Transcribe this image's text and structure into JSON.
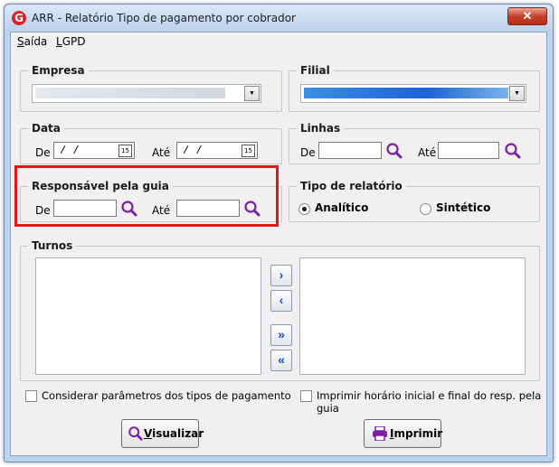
{
  "window": {
    "title": "ARR - Relatório Tipo de pagamento por cobrador",
    "logo_letter": "G",
    "close_glyph": "✕"
  },
  "menu": [
    {
      "label": "Saída",
      "accel_index": 0
    },
    {
      "label": "LGPD",
      "accel_index": 0
    }
  ],
  "empresa": {
    "legend": "Empresa"
  },
  "filial": {
    "legend": "Filial"
  },
  "data": {
    "legend": "Data",
    "from_label": "De",
    "to_label": "Até",
    "from_value": "/ /",
    "to_value": "/ /",
    "calendar_glyph": "15"
  },
  "linhas": {
    "legend": "Linhas",
    "from_label": "De",
    "to_label": "Até",
    "from_value": "",
    "to_value": ""
  },
  "responsavel": {
    "legend": "Responsável pela guia",
    "from_label": "De",
    "to_label": "Até",
    "from_value": "",
    "to_value": ""
  },
  "tipo": {
    "legend": "Tipo de relatório",
    "options": [
      {
        "label": "Analítico",
        "selected": true
      },
      {
        "label": "Sintético",
        "selected": false
      }
    ]
  },
  "turnos": {
    "legend": "Turnos",
    "move_buttons": [
      {
        "glyph": "›"
      },
      {
        "glyph": "‹"
      },
      {
        "glyph": "»"
      },
      {
        "glyph": "«"
      }
    ]
  },
  "options": {
    "considerar_label": "Considerar parâmetros dos tipos de pagamento",
    "considerar_checked": false,
    "imprimir_horario_label": "Imprimir horário inicial e final do resp. pela guia",
    "imprimir_horario_checked": false
  },
  "buttons": {
    "visualizar": "Visualizar",
    "visualizar_accel": "V",
    "imprimir": "Imprimir",
    "imprimir_accel": "I"
  },
  "colors": {
    "accent": "#1b47d6",
    "highlight": "#e11818",
    "icon_purple": "#7b1fa2"
  }
}
